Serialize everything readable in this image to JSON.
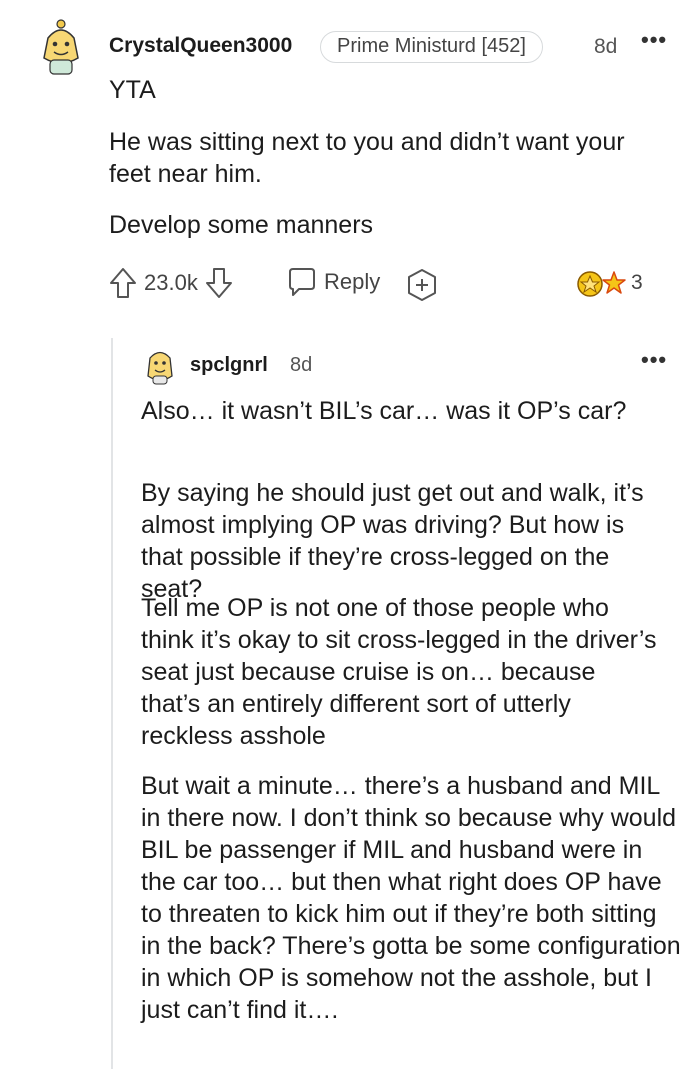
{
  "comment": {
    "username": "CrystalQueen3000",
    "flair": "Prime Ministurd [452]",
    "time": "8d",
    "more": "•••",
    "paragraphs": [
      "YTA",
      "He was sitting next to you and didn’t want your feet near him.",
      "Develop some manners"
    ],
    "score": "23.0k",
    "reply_label": "Reply",
    "award_count": "3"
  },
  "reply": {
    "username": "spclgnrl",
    "time": "8d",
    "more": "•••",
    "paragraphs": [
      "Also… it wasn’t BIL’s car… was it OP’s car?",
      "By saying he should just get out and walk, it’s almost implying OP was driving? But how is that possible if they’re cross-legged on the seat?",
      "Tell me OP is not one of those people who think it’s okay to sit cross-legged in the driver’s seat just because cruise is on… because that’s an entirely different sort of utterly reckless asshole",
      "But wait a minute… there’s a husband and MIL in there now. I don’t think so because why would BIL be passenger if MIL and husband were in the car too… but then what right does OP have to threaten to kick him out if they’re both sitting in the back? There’s gotta be some configuration in which OP is somehow not the asshole, but I just can’t find it…."
    ]
  },
  "colors": {
    "text": "#1c1c1c",
    "meta": "#555555",
    "thread_line": "#e2e4e6",
    "award_gold": "#f5c518"
  }
}
